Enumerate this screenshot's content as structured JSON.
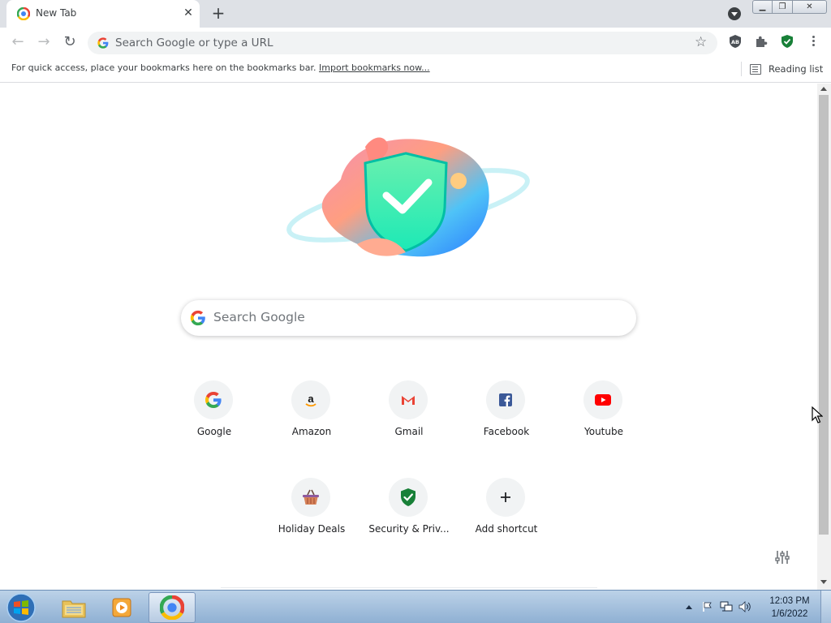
{
  "tab": {
    "title": "New Tab"
  },
  "omnibox": {
    "placeholder": "Search Google or type a URL"
  },
  "bookmarks_bar": {
    "message": "For quick access, place your bookmarks here on the bookmarks bar.",
    "import_link": "Import bookmarks now...",
    "reading_list": "Reading list"
  },
  "search": {
    "placeholder": "Search Google"
  },
  "shortcuts": [
    {
      "label": "Google",
      "icon": "google-icon"
    },
    {
      "label": "Amazon",
      "icon": "amazon-icon"
    },
    {
      "label": "Gmail",
      "icon": "gmail-icon"
    },
    {
      "label": "Facebook",
      "icon": "facebook-icon"
    },
    {
      "label": "Youtube",
      "icon": "youtube-icon"
    },
    {
      "label": "Holiday Deals",
      "icon": "basket-icon"
    },
    {
      "label": "Security & Priv...",
      "icon": "shield-check-icon"
    },
    {
      "label": "Add shortcut",
      "icon": "plus-icon"
    }
  ],
  "clock": {
    "time": "12:03 PM",
    "date": "1/6/2022"
  },
  "colors": {
    "tabstrip": "#dee1e6",
    "omnibox": "#f1f3f4",
    "shortcut_circle": "#f1f3f4",
    "shield_green": "#188038",
    "taskbar": "#a9c4e0"
  }
}
